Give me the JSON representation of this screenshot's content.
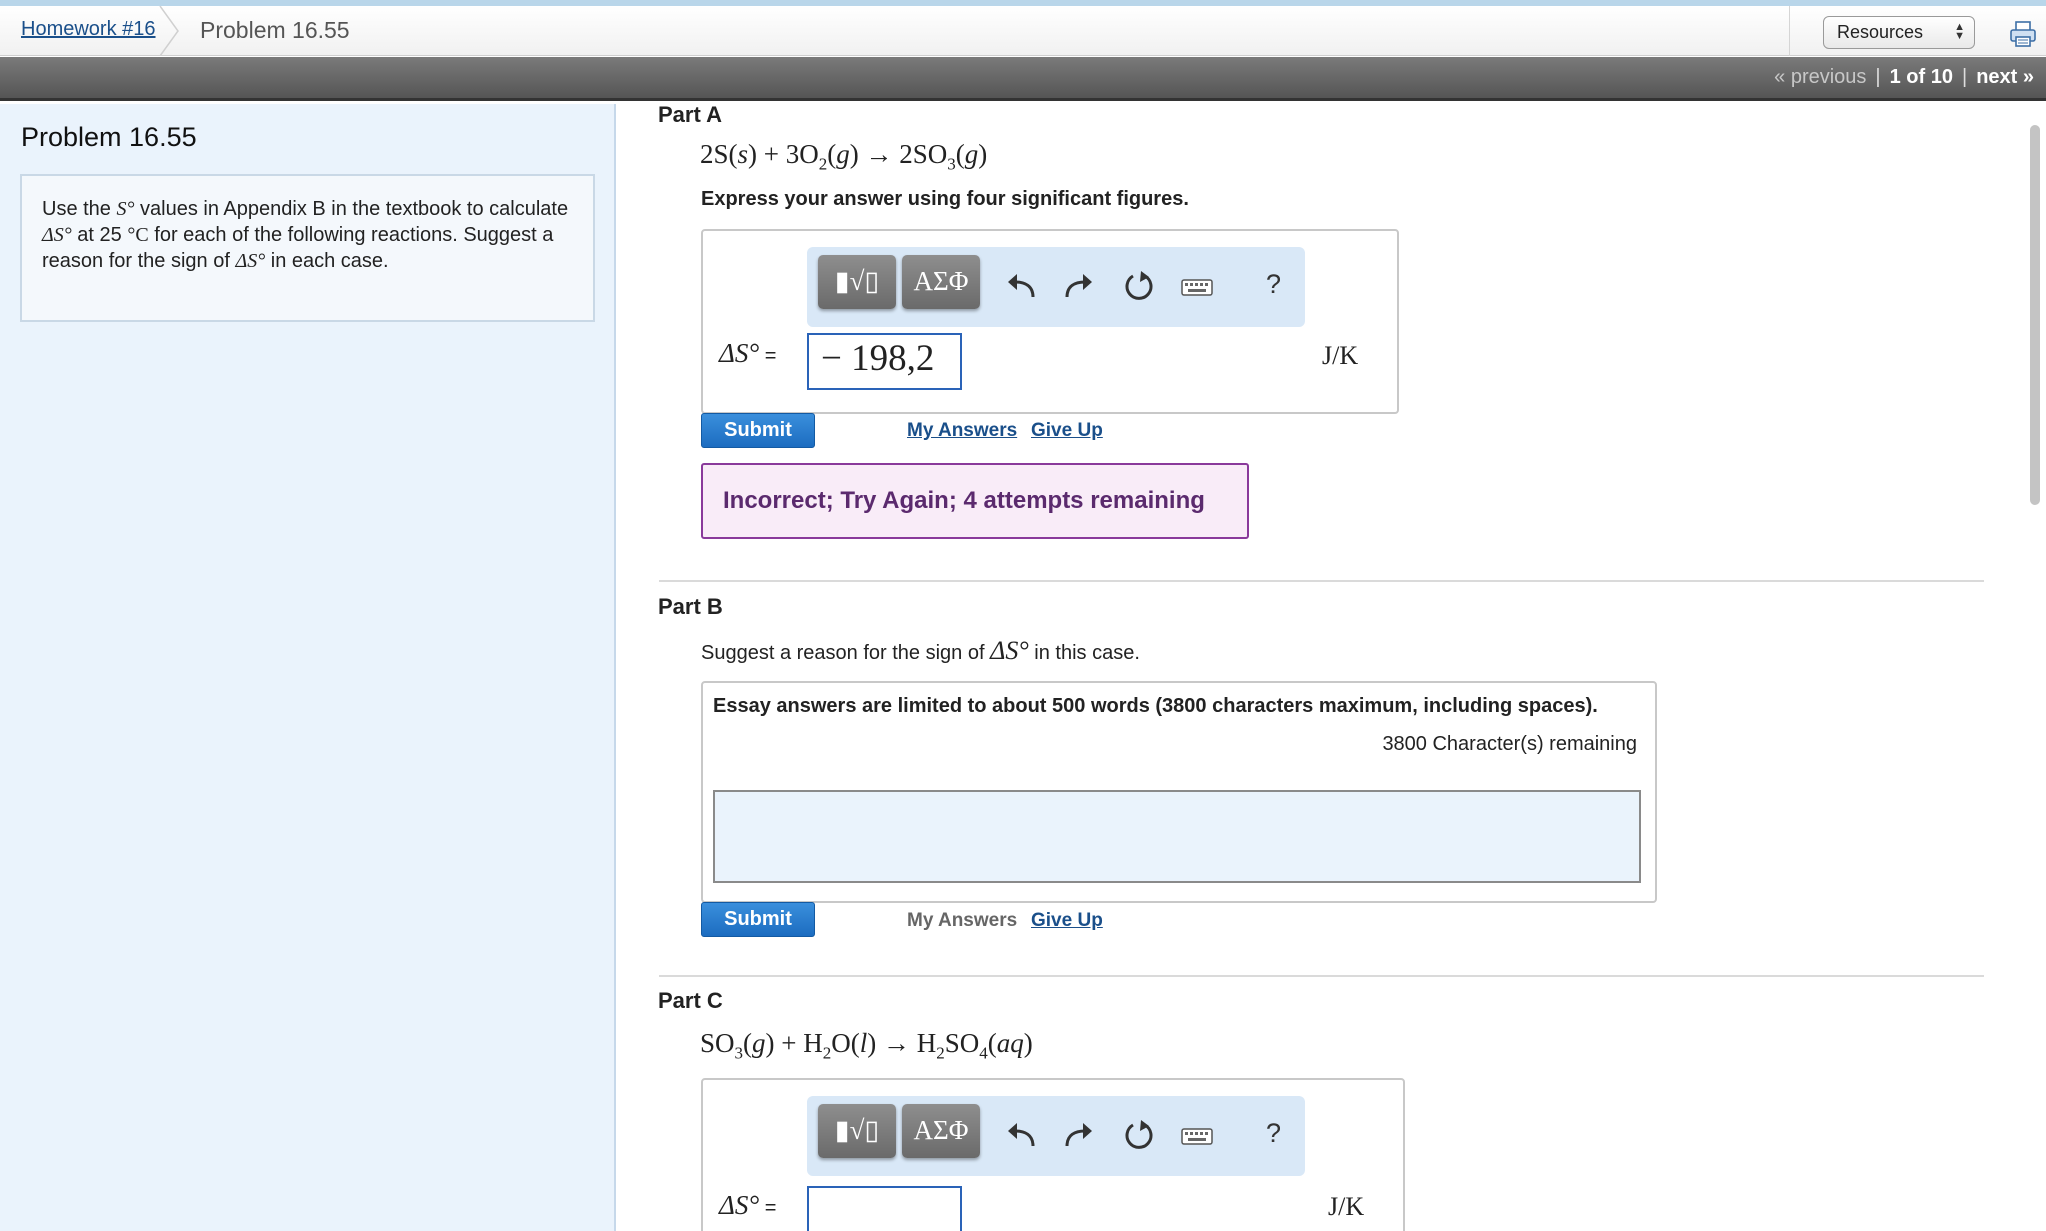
{
  "header": {
    "breadcrumb_home": "Homework #16",
    "breadcrumb_current": "Problem 16.55",
    "resources_label": "Resources"
  },
  "pager": {
    "previous": "« previous",
    "count": "1 of 10",
    "next": "next »"
  },
  "sidebar": {
    "title": "Problem 16.55",
    "text_1": "Use the ",
    "symbol_1": "S°",
    "text_2": " values in Appendix B in the textbook to calculate ",
    "symbol_2": "ΔS°",
    "text_3": " at 25 ",
    "symbol_3": "°C",
    "text_4": " for each of the following reactions. Suggest a reason for the sign of ",
    "symbol_4": "ΔS°",
    "text_5": " in each case."
  },
  "part_a": {
    "label": "Part A",
    "instruction": "Express your answer using four significant figures.",
    "answer_label": "ΔS°",
    "equals": " =",
    "answer_value": "− 198,2",
    "units": "J/K",
    "submit_label": "Submit",
    "my_answers_label": "My Answers",
    "give_up_label": "Give Up",
    "feedback": "Incorrect; Try Again; 4 attempts remaining"
  },
  "part_b": {
    "label": "Part B",
    "prompt_1": "Suggest a reason for the sign of ",
    "prompt_symbol": "ΔS°",
    "prompt_2": " in this case.",
    "essay_note": "Essay answers are limited to about 500 words (3800 characters maximum, including spaces).",
    "remaining": "3800 Character(s) remaining",
    "essay_value": "",
    "submit_label": "Submit",
    "my_answers_label": "My Answers",
    "give_up_label": "Give Up"
  },
  "part_c": {
    "label": "Part C",
    "answer_label": "ΔS°",
    "equals": " =",
    "answer_value": "",
    "units": "J/K"
  },
  "math_toolbar": {
    "templates_glyph": "▮√▯",
    "symbols_glyph": "ΑΣΦ",
    "help_label": "?"
  },
  "colors": {
    "link": "#1a4f8a",
    "submit": "#1c6cc0",
    "sidebar_bg": "#eaf3fc",
    "feedback_border": "#8a3a9b",
    "feedback_text": "#5b2a6e"
  },
  "icons": [
    "printer-icon",
    "undo-icon",
    "redo-icon",
    "reset-icon",
    "keyboard-icon",
    "resize-grip-icon"
  ]
}
